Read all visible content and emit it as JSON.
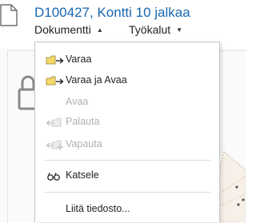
{
  "header": {
    "document_title": "D100427, Kontti 10 jalkaa",
    "documents_menu_label": "Dokumentti",
    "documents_menu_caret": "▲",
    "tools_menu_label": "Työkalut",
    "tools_menu_caret": "▼",
    "document_icon": "document-icon"
  },
  "background": {
    "lock_icon": "lock-icon"
  },
  "document_menu": {
    "items": [
      {
        "label": "Varaa",
        "icon": "folder-arrow-icon",
        "enabled": true
      },
      {
        "label": "Varaa ja Avaa",
        "icon": "folder-arrow-icon",
        "enabled": true
      },
      {
        "label": "Avaa",
        "icon": "",
        "enabled": false
      },
      {
        "label": "Palauta",
        "icon": "folder-return-icon",
        "enabled": false
      },
      {
        "label": "Vapauta",
        "icon": "folder-release-icon",
        "enabled": false
      },
      {
        "label": "Katsele",
        "icon": "glasses-icon",
        "enabled": true
      },
      {
        "label": "Liitä tiedosto...",
        "icon": "",
        "enabled": true
      }
    ]
  },
  "colors": {
    "title_blue": "#1a68b2",
    "folder_yellow": "#f3d96a",
    "disabled_text": "#b0b0b0"
  }
}
